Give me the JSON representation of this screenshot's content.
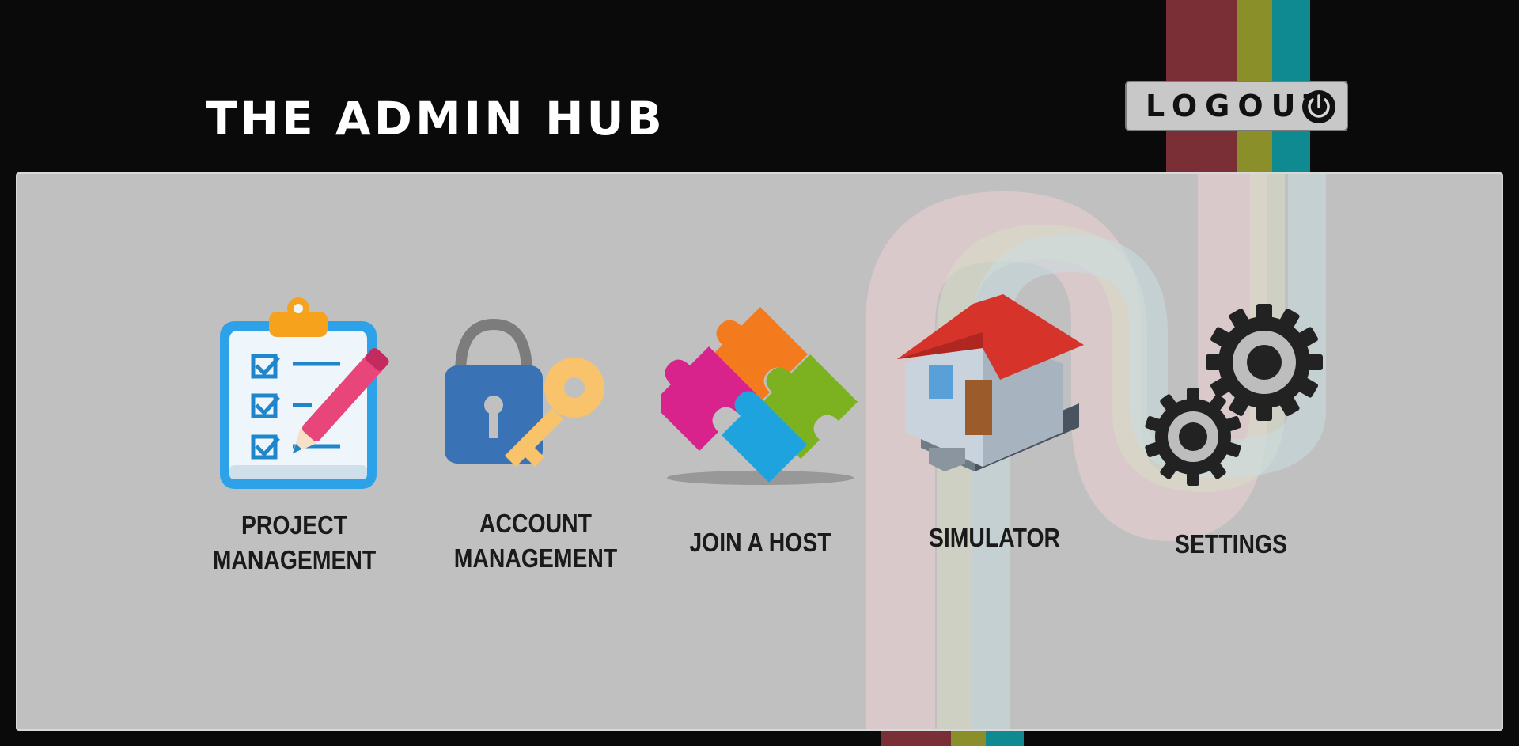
{
  "header": {
    "title": "THE ADMIN HUB",
    "logout_label": "LOGOUT",
    "logout_icon": "power-icon"
  },
  "tiles": [
    {
      "label_line1": "PROJECT",
      "label_line2": "MANAGEMENT",
      "icon": "clipboard-checklist-icon"
    },
    {
      "label_line1": "ACCOUNT",
      "label_line2": "MANAGEMENT",
      "icon": "lock-key-icon"
    },
    {
      "label_line1": "JOIN A HOST",
      "label_line2": "",
      "icon": "puzzle-icon"
    },
    {
      "label_line1": "SIMULATOR",
      "label_line2": "",
      "icon": "house-icon"
    },
    {
      "label_line1": "SETTINGS",
      "label_line2": "",
      "icon": "gears-icon"
    }
  ],
  "colors": {
    "background": "#0a0a0a",
    "panel": "#c0c0c0",
    "stripe_red": "#7a2f36",
    "stripe_olive": "#8a8f2a",
    "stripe_teal": "#0f8a90"
  }
}
